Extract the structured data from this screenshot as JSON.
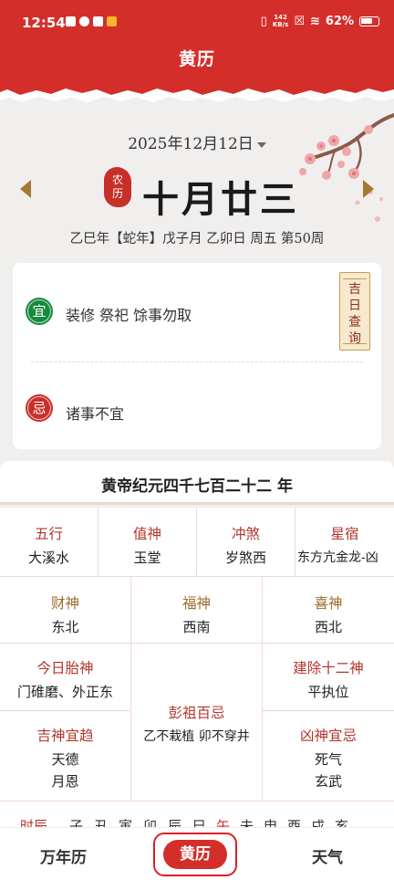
{
  "status_bar": {
    "time": "12:54",
    "speed_top": "142",
    "speed_bottom": "KB/s",
    "battery": "62%"
  },
  "header": {
    "title": "黄历"
  },
  "date": {
    "solar": "2025年12月12日",
    "seal": "农历",
    "lunar": "十月廿三",
    "ganzhi": "乙巳年【蛇年】戊子月 乙卯日  周五  第50周"
  },
  "yiji": {
    "yi_badge": "宜",
    "yi_items": "装修 祭祀 馀事勿取",
    "ji_badge": "忌",
    "ji_items": "诸事不宜",
    "jiri_button": "吉日查询"
  },
  "era": "黄帝纪元四千七百二十二 年",
  "grid": {
    "wuxing": {
      "label": "五行",
      "value": "大溪水"
    },
    "zhishen": {
      "label": "值神",
      "value": "玉堂"
    },
    "chongsha": {
      "label": "冲煞",
      "value": "岁煞西"
    },
    "xingsu": {
      "label": "星宿",
      "value": "东方亢金龙-凶"
    },
    "caishen": {
      "label": "财神",
      "value": "东北"
    },
    "fushen": {
      "label": "福神",
      "value": "西南"
    },
    "xishen": {
      "label": "喜神",
      "value": "西北"
    },
    "taishen": {
      "label": "今日胎神",
      "value": "门碓磨、外正东"
    },
    "pengzu": {
      "label": "彭祖百忌",
      "value": "乙不栽植 卯不穿井"
    },
    "jianchu": {
      "label": "建除十二神",
      "value": "平执位"
    },
    "jishen": {
      "label": "吉神宜趋",
      "value1": "天德",
      "value2": "月恩"
    },
    "xiongshen": {
      "label": "凶神宜忌",
      "value1": "死气",
      "value2": "玄武"
    }
  },
  "shichen": {
    "label": "时辰",
    "branches": [
      "子",
      "丑",
      "寅",
      "卯",
      "辰",
      "巳",
      "午",
      "未",
      "申",
      "酉",
      "戌",
      "亥"
    ]
  },
  "nav": {
    "wannianli": "万年历",
    "huangli": "黄历",
    "tianqi": "天气"
  },
  "colors": {
    "primary_red": "#d42e2a",
    "accent_gold": "#a27a30",
    "yi_green": "#178a3c"
  }
}
